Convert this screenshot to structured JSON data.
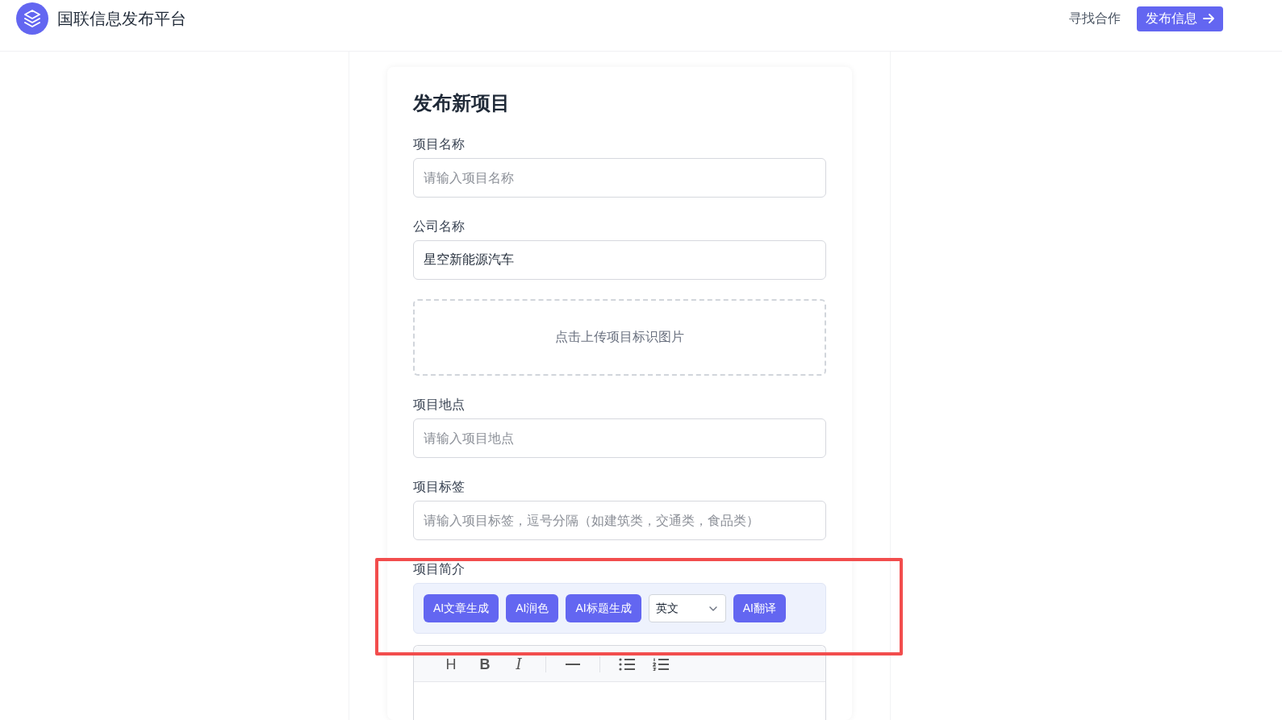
{
  "header": {
    "title": "国联信息发布平台",
    "nav_link": "寻找合作",
    "publish_button": "发布信息"
  },
  "form": {
    "title": "发布新项目",
    "fields": [
      {
        "kind": "input",
        "label": "项目名称",
        "placeholder": "请输入项目名称"
      },
      {
        "kind": "input",
        "label": "公司名称",
        "value": "星空新能源汽车"
      },
      {
        "kind": "upload",
        "text": "点击上传项目标识图片"
      },
      {
        "kind": "input",
        "label": "项目地点",
        "placeholder": "请输入项目地点"
      },
      {
        "kind": "input",
        "label": "项目标签",
        "placeholder": "请输入项目标签，逗号分隔（如建筑类，交通类，食品类）"
      },
      {
        "kind": "editor",
        "label": "项目简介",
        "highlighted": true,
        "ai_tools": [
          {
            "kind": "button",
            "label": "AI文章生成"
          },
          {
            "kind": "button",
            "label": "AI润色"
          },
          {
            "kind": "button",
            "label": "AI标题生成"
          },
          {
            "kind": "select",
            "value": "英文"
          },
          {
            "kind": "button",
            "label": "AI翻译"
          }
        ],
        "toolbar_groups": [
          [
            {
              "kind": "heading",
              "label": "H"
            },
            {
              "kind": "bold",
              "label": "B"
            },
            {
              "kind": "italic",
              "label": "I"
            }
          ],
          [
            {
              "kind": "horizontal-rule"
            }
          ],
          [
            {
              "kind": "bullet-list"
            },
            {
              "kind": "ordered-list"
            }
          ]
        ]
      }
    ]
  }
}
